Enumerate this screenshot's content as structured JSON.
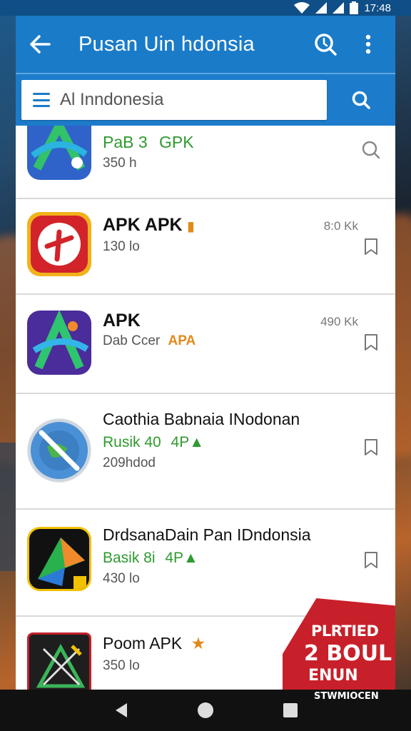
{
  "status_bar": {
    "time": "17:48",
    "icons": [
      "wifi-icon",
      "signal-icon",
      "signal-icon",
      "battery-icon"
    ]
  },
  "app_bar": {
    "title": "Pusan Uin hdonsia",
    "back_icon": "arrow-left-icon",
    "search_icon": "search-icon",
    "more_icon": "more-vert-icon"
  },
  "search": {
    "menu_icon": "menu-icon",
    "value": "Al Inndonesia",
    "button_icon": "search-icon"
  },
  "apps": [
    {
      "name_parts": [
        "PaB 3",
        "GPK"
      ],
      "sub": "350 h",
      "size": "",
      "action_icon": "search-icon"
    },
    {
      "name_parts": [
        "APK APK",
        "▮"
      ],
      "sub": "130 lo",
      "size": "8:0 Kk",
      "action_icon": "bookmark-icon"
    },
    {
      "name_parts": [
        "APK"
      ],
      "sub_parts": [
        "Dab Ccer",
        "APA"
      ],
      "size": "490 Kk",
      "action_icon": "bookmark-icon"
    },
    {
      "name_parts": [
        "Caothia Babnaia INodonan"
      ],
      "sub_parts": [
        "Rusik 40",
        "4P▲"
      ],
      "detail": "209hdod",
      "size": "",
      "action_icon": "bookmark-icon"
    },
    {
      "name_parts": [
        "DrdsanaDain Pan IDndonsia"
      ],
      "sub_parts": [
        "Basik 8i",
        "4P▲"
      ],
      "detail": "430 lo",
      "size": "",
      "action_icon": "bookmark-icon"
    },
    {
      "name_parts": [
        "Poom APK",
        "★"
      ],
      "sub": "350 lo",
      "size": "",
      "action_icon": ""
    }
  ],
  "promo": {
    "line1": "PLRTIED",
    "line2": "2 BOUL",
    "line3": "ENUN",
    "footer": "STWMIOCEN"
  },
  "nav": {
    "back": "nav-back-icon",
    "home": "nav-home-icon",
    "recents": "nav-recents-icon"
  },
  "colors": {
    "primary": "#1a7bc9",
    "accent_green": "#2f9a2f",
    "accent_orange": "#e08a1c",
    "promo_red": "#c8202a"
  }
}
